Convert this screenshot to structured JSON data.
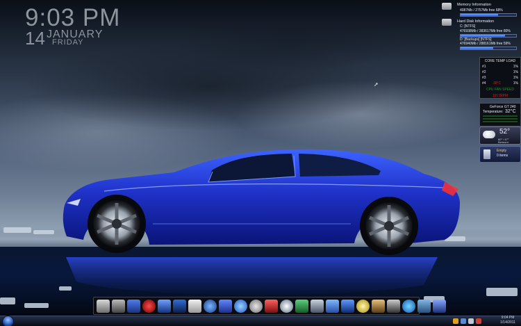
{
  "clock": {
    "time": "9:03 PM",
    "day": "14",
    "month": "JANUARY",
    "weekday": "FRIDAY"
  },
  "memory": {
    "title": "Memory Information",
    "detail": "4087Mb / 2757Mb  free 68%",
    "free_fraction": 0.68
  },
  "disk": {
    "title": "Hard Disk Information",
    "drive_c_label": "C: [NTFS]",
    "drive_c_detail": "476938Mb / 383617Mb  free 80%",
    "drive_c_free_fraction": 0.8,
    "drive_d_label": "D: [Backups] [NTFS]",
    "drive_d_detail": "476940Mb / 288161Mb  free 59%",
    "drive_d_free_fraction": 0.59
  },
  "core_temp": {
    "title": "CORE TEMP LOAD",
    "cores": [
      {
        "name": "#1",
        "load": "1%"
      },
      {
        "name": "#2",
        "load": "1%"
      },
      {
        "name": "#3",
        "load": "1%"
      },
      {
        "name": "#4",
        "temp": "38°C",
        "load": "1%"
      }
    ],
    "fan_label": "CPU FAN SPEED",
    "fan_speed": "1917RPM"
  },
  "gpu": {
    "name": "GeForce GT 240",
    "temp_label": "Temperature:",
    "temp_value": "32°C"
  },
  "weather": {
    "temp": "52°",
    "range": "60° / 47°",
    "location": "Belmont"
  },
  "recycle": {
    "label": "Empty",
    "items": "0 items"
  },
  "taskbar": {
    "time": "9:04 PM",
    "date": "1/14/2011"
  },
  "colors": {
    "accent": "#2e5bd8",
    "alert": "#d02020",
    "text": "#8d949c"
  }
}
